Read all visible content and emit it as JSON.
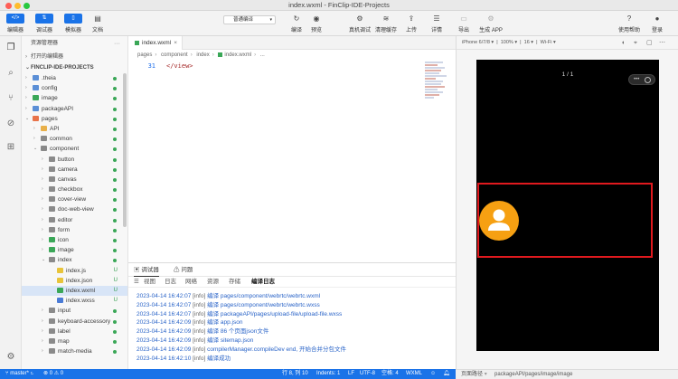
{
  "window": {
    "title": "index.wxml - FinClip-IDE-Projects"
  },
  "toolbar": {
    "editor": "编辑器",
    "debugger": "调试器",
    "simulator": "模拟器",
    "docs": "文档",
    "compile_mode": "普通编译",
    "compile": "编译",
    "preview": "预览",
    "real_debug": "真机调试",
    "clear_cache": "清理缓存",
    "upload": "上传",
    "details": "详情",
    "export": "导出",
    "generate_app": "生成 APP",
    "help": "使用帮助",
    "login": "登录"
  },
  "explorer": {
    "title": "资源管理器",
    "open_editors": "打开的编辑器",
    "project": "FINCLIP-IDE-PROJECTS",
    "tree": [
      {
        "name": ".theia",
        "depth": 1,
        "folder": true,
        "open": false,
        "color": "#5b8fd6",
        "status": "dot"
      },
      {
        "name": "config",
        "depth": 1,
        "folder": true,
        "open": false,
        "color": "#5b8fd6",
        "status": "dot"
      },
      {
        "name": "image",
        "depth": 1,
        "folder": true,
        "open": false,
        "color": "#3aa757",
        "status": "dot"
      },
      {
        "name": "packageAPI",
        "depth": 1,
        "folder": true,
        "open": false,
        "color": "#5b8fd6",
        "status": "dot"
      },
      {
        "name": "pages",
        "depth": 1,
        "folder": true,
        "open": true,
        "color": "#e8734a",
        "status": "dot"
      },
      {
        "name": "API",
        "depth": 2,
        "folder": true,
        "open": false,
        "color": "#e8b04a",
        "status": "dot"
      },
      {
        "name": "common",
        "depth": 2,
        "folder": true,
        "open": false,
        "color": "#8a8a8a",
        "status": "dot"
      },
      {
        "name": "component",
        "depth": 2,
        "folder": true,
        "open": true,
        "color": "#8a8a8a",
        "status": "dot"
      },
      {
        "name": "button",
        "depth": 3,
        "folder": true,
        "open": false,
        "color": "#8a8a8a",
        "status": "dot"
      },
      {
        "name": "camera",
        "depth": 3,
        "folder": true,
        "open": false,
        "color": "#8a8a8a",
        "status": "dot"
      },
      {
        "name": "canvas",
        "depth": 3,
        "folder": true,
        "open": false,
        "color": "#8a8a8a",
        "status": "dot"
      },
      {
        "name": "checkbox",
        "depth": 3,
        "folder": true,
        "open": false,
        "color": "#8a8a8a",
        "status": "dot"
      },
      {
        "name": "cover-view",
        "depth": 3,
        "folder": true,
        "open": false,
        "color": "#8a8a8a",
        "status": "dot"
      },
      {
        "name": "doc-web-view",
        "depth": 3,
        "folder": true,
        "open": false,
        "color": "#8a8a8a",
        "status": "dot"
      },
      {
        "name": "editor",
        "depth": 3,
        "folder": true,
        "open": false,
        "color": "#8a8a8a",
        "status": "dot"
      },
      {
        "name": "form",
        "depth": 3,
        "folder": true,
        "open": false,
        "color": "#8a8a8a",
        "status": "dot"
      },
      {
        "name": "icon",
        "depth": 3,
        "folder": true,
        "open": false,
        "color": "#3aa757",
        "status": "dot"
      },
      {
        "name": "image",
        "depth": 3,
        "folder": true,
        "open": false,
        "color": "#3aa757",
        "status": "dot"
      },
      {
        "name": "index",
        "depth": 3,
        "folder": true,
        "open": true,
        "color": "#8a8a8a",
        "status": "dot"
      },
      {
        "name": "index.js",
        "depth": 4,
        "folder": false,
        "color": "#e8c43a",
        "status": "U"
      },
      {
        "name": "index.json",
        "depth": 4,
        "folder": false,
        "color": "#e8c43a",
        "status": "U"
      },
      {
        "name": "index.wxml",
        "depth": 4,
        "folder": false,
        "color": "#3aa757",
        "status": "U",
        "selected": true
      },
      {
        "name": "index.wxss",
        "depth": 4,
        "folder": false,
        "color": "#4a7bd6",
        "status": "U"
      },
      {
        "name": "input",
        "depth": 3,
        "folder": true,
        "open": false,
        "color": "#8a8a8a",
        "status": "dot"
      },
      {
        "name": "keyboard-accessory",
        "depth": 3,
        "folder": true,
        "open": false,
        "color": "#8a8a8a",
        "status": "dot"
      },
      {
        "name": "label",
        "depth": 3,
        "folder": true,
        "open": false,
        "color": "#8a8a8a",
        "status": "dot"
      },
      {
        "name": "map",
        "depth": 3,
        "folder": true,
        "open": false,
        "color": "#8a8a8a",
        "status": "dot"
      },
      {
        "name": "match-media",
        "depth": 3,
        "folder": true,
        "open": false,
        "color": "#8a8a8a",
        "status": "dot"
      }
    ]
  },
  "editor": {
    "tab": "index.wxml",
    "breadcrumb": [
      "pages",
      "component",
      "index",
      "index.wxml",
      "..."
    ],
    "line_number": "31",
    "code": "</view>"
  },
  "panel": {
    "tabs": [
      "调试器",
      "问题"
    ],
    "subtabs": [
      "视图",
      "日志",
      "网络",
      "资源",
      "存储",
      "编译日志"
    ],
    "logs": [
      {
        "time": "2023-04-14 16:42:07",
        "level": "[info]",
        "msg": "编译 pages/component/webrtc/webrtc.wxml"
      },
      {
        "time": "2023-04-14 16:42:07",
        "level": "[info]",
        "msg": "编译 pages/component/webrtc/webrtc.wxss"
      },
      {
        "time": "2023-04-14 16:42:07",
        "level": "[info]",
        "msg": "编译 packageAPI/pages/upload-file/upload-file.wxss"
      },
      {
        "time": "2023-04-14 16:42:09",
        "level": "[info]",
        "msg": "编译 app.json"
      },
      {
        "time": "2023-04-14 16:42:09",
        "level": "[info]",
        "msg": "编译 86 个页面json文件"
      },
      {
        "time": "2023-04-14 16:42:09",
        "level": "[info]",
        "msg": "编译 sitemap.json"
      },
      {
        "time": "2023-04-14 16:42:09",
        "level": "[info]",
        "msg": "compilerManager.compileDev end, 开始合并分包文件"
      },
      {
        "time": "2023-04-14 16:42:10",
        "level": "[info]",
        "msg": "编译成功"
      }
    ]
  },
  "simulator": {
    "device": "iPhone 6/7/8",
    "zoom": "100%",
    "font_size": "16",
    "network": "Wi-Fi",
    "page_count": "1 / 1",
    "page_path_label": "页面路径",
    "page_path": "packageAPI/pages/image/image"
  },
  "statusbar": {
    "branch": "master*",
    "problems": "0",
    "warnings": "0",
    "position": "行 8, 列 10",
    "indent": "Indents: 1",
    "eol": "LF",
    "encoding": "UTF-8",
    "spaces": "空格: 4",
    "language": "WXML"
  },
  "colors": {
    "accent": "#1a73e8",
    "highlight": "#e0191e",
    "avatar": "#f6a012"
  }
}
